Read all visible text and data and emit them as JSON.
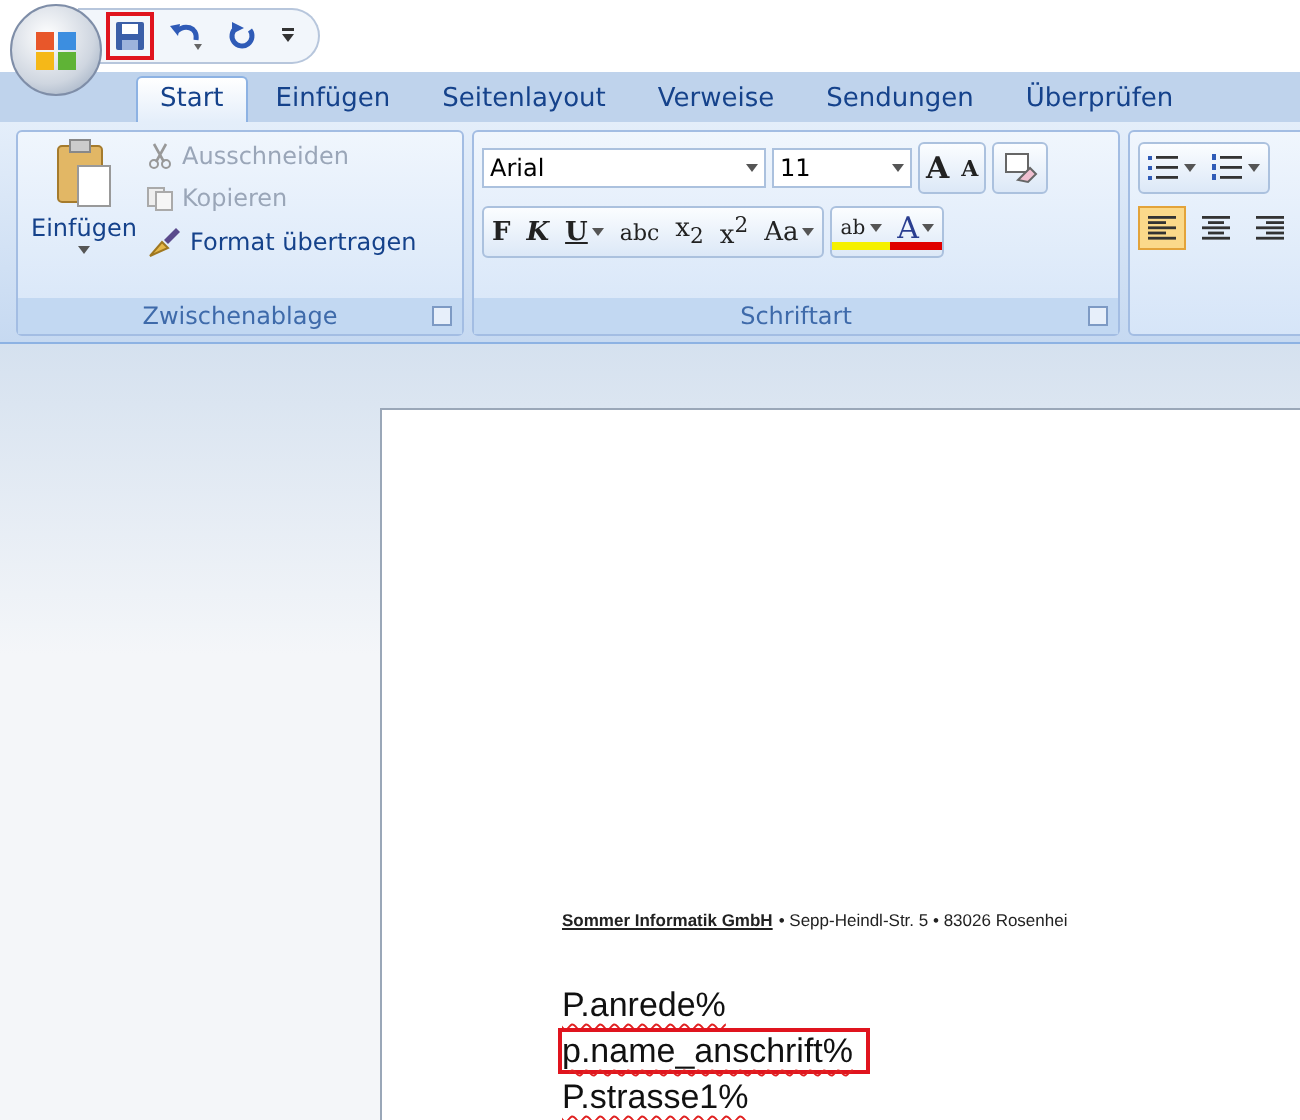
{
  "quick_access": [
    {
      "kind": "save",
      "highlighted": true
    },
    {
      "kind": "undo",
      "highlighted": false
    },
    {
      "kind": "redo",
      "highlighted": false
    },
    {
      "kind": "customize"
    }
  ],
  "tabs": [
    {
      "label": "Start",
      "selected": true
    },
    {
      "label": "Einfügen",
      "selected": false
    },
    {
      "label": "Seitenlayout",
      "selected": false
    },
    {
      "label": "Verweise",
      "selected": false
    },
    {
      "label": "Sendungen",
      "selected": false
    },
    {
      "label": "Überprüfen",
      "selected": false
    }
  ],
  "clipboard": {
    "label": "Zwischenablage",
    "paste": "Einfügen",
    "items": [
      {
        "kind": "cut",
        "label": "Ausschneiden",
        "disabled": true
      },
      {
        "kind": "copy",
        "label": "Kopieren",
        "disabled": true
      },
      {
        "kind": "brush",
        "label": "Format übertragen",
        "disabled": false
      }
    ]
  },
  "font_group": {
    "label": "Schriftart",
    "font": "Arial",
    "size": "11",
    "size_buttons": [
      {
        "kind": "grow",
        "label": "A"
      },
      {
        "kind": "shrink",
        "label": "A"
      }
    ],
    "format_buttons": [
      {
        "kind": "bold",
        "label": "F",
        "dropdown": false
      },
      {
        "kind": "italic",
        "label": "K",
        "dropdown": false
      },
      {
        "kind": "underline",
        "label": "U",
        "dropdown": true
      },
      {
        "kind": "strike",
        "label": "abc",
        "dropdown": false
      },
      {
        "kind": "sub",
        "label": "x$_{2}$",
        "dropdown": false
      },
      {
        "kind": "sup",
        "label": "x$^{2}$",
        "dropdown": false
      },
      {
        "kind": "case",
        "label": "Aa",
        "dropdown": true
      },
      {
        "kind": "highlight",
        "label": "ab",
        "dropdown": true
      },
      {
        "kind": "color",
        "label": "A",
        "dropdown": true
      }
    ]
  },
  "paragraph_group": {
    "align_buttons": [
      {
        "kind": "left",
        "selected": true
      },
      {
        "kind": "center",
        "selected": false
      },
      {
        "kind": "right",
        "selected": false
      }
    ]
  },
  "document": {
    "letterhead": {
      "company": "Sommer Informatik GmbH",
      "address": "• Sepp-Heindl-Str. 5 • 83026 Rosenhei"
    },
    "lines": [
      {
        "text": "P.anrede%",
        "spelling_error": true,
        "highlighted": false
      },
      {
        "text": "p.name_anschrift%",
        "spelling_error": true,
        "highlighted": true
      },
      {
        "text": "P.strasse1%",
        "spelling_error": true,
        "highlighted": false
      }
    ]
  }
}
